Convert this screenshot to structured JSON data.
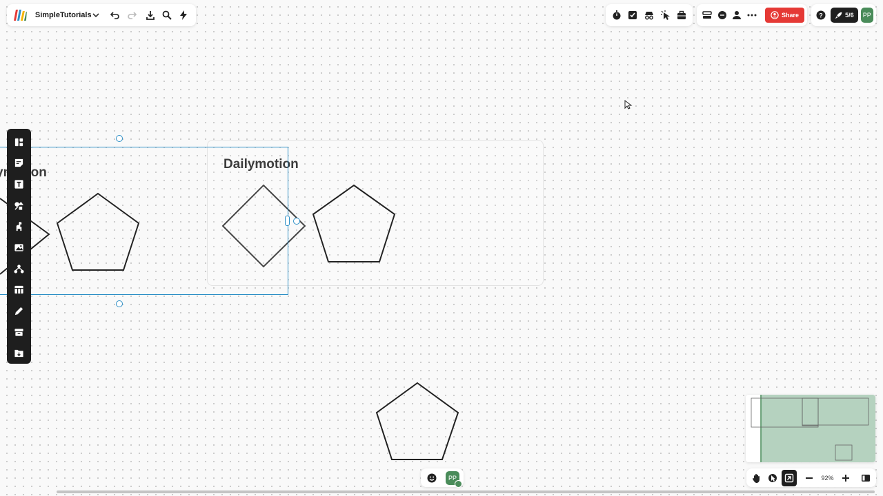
{
  "board": {
    "name": "SimpleTutorials"
  },
  "top_right": {
    "share_label": "Share",
    "credits": "5/6",
    "user_initials": "PP"
  },
  "canvas": {
    "frame1_title_partial": "ymotion",
    "frame2_title": "Dailymotion"
  },
  "bottom": {
    "user_initials": "PP",
    "zoom": "92%"
  },
  "colors": {
    "accent": "#2d8fc6",
    "share": "#e53935",
    "avatar": "#4a8c5a",
    "toolbar": "#1e1e1e"
  },
  "icons": {
    "top_left": [
      "undo-icon",
      "redo-icon",
      "download-icon",
      "search-icon",
      "lightning-icon"
    ],
    "top_center": [
      "timer-icon",
      "checkbox-icon",
      "incognito-icon",
      "cursor-sparkle-icon",
      "toolbox-icon"
    ],
    "top_right": [
      "layout-icon",
      "comment-icon",
      "person-icon",
      "more-icon"
    ],
    "left_toolbar": [
      "templates-icon",
      "sticky-note-icon",
      "text-icon",
      "shapes-icon",
      "llama-icon",
      "image-icon",
      "mindmap-icon",
      "table-icon",
      "pen-icon",
      "archive-icon",
      "upload-icon"
    ],
    "bottom_right": [
      "hand-icon",
      "cursor-icon",
      "map-icon",
      "zoom-out-icon",
      "zoom-in-icon",
      "panel-icon"
    ]
  }
}
